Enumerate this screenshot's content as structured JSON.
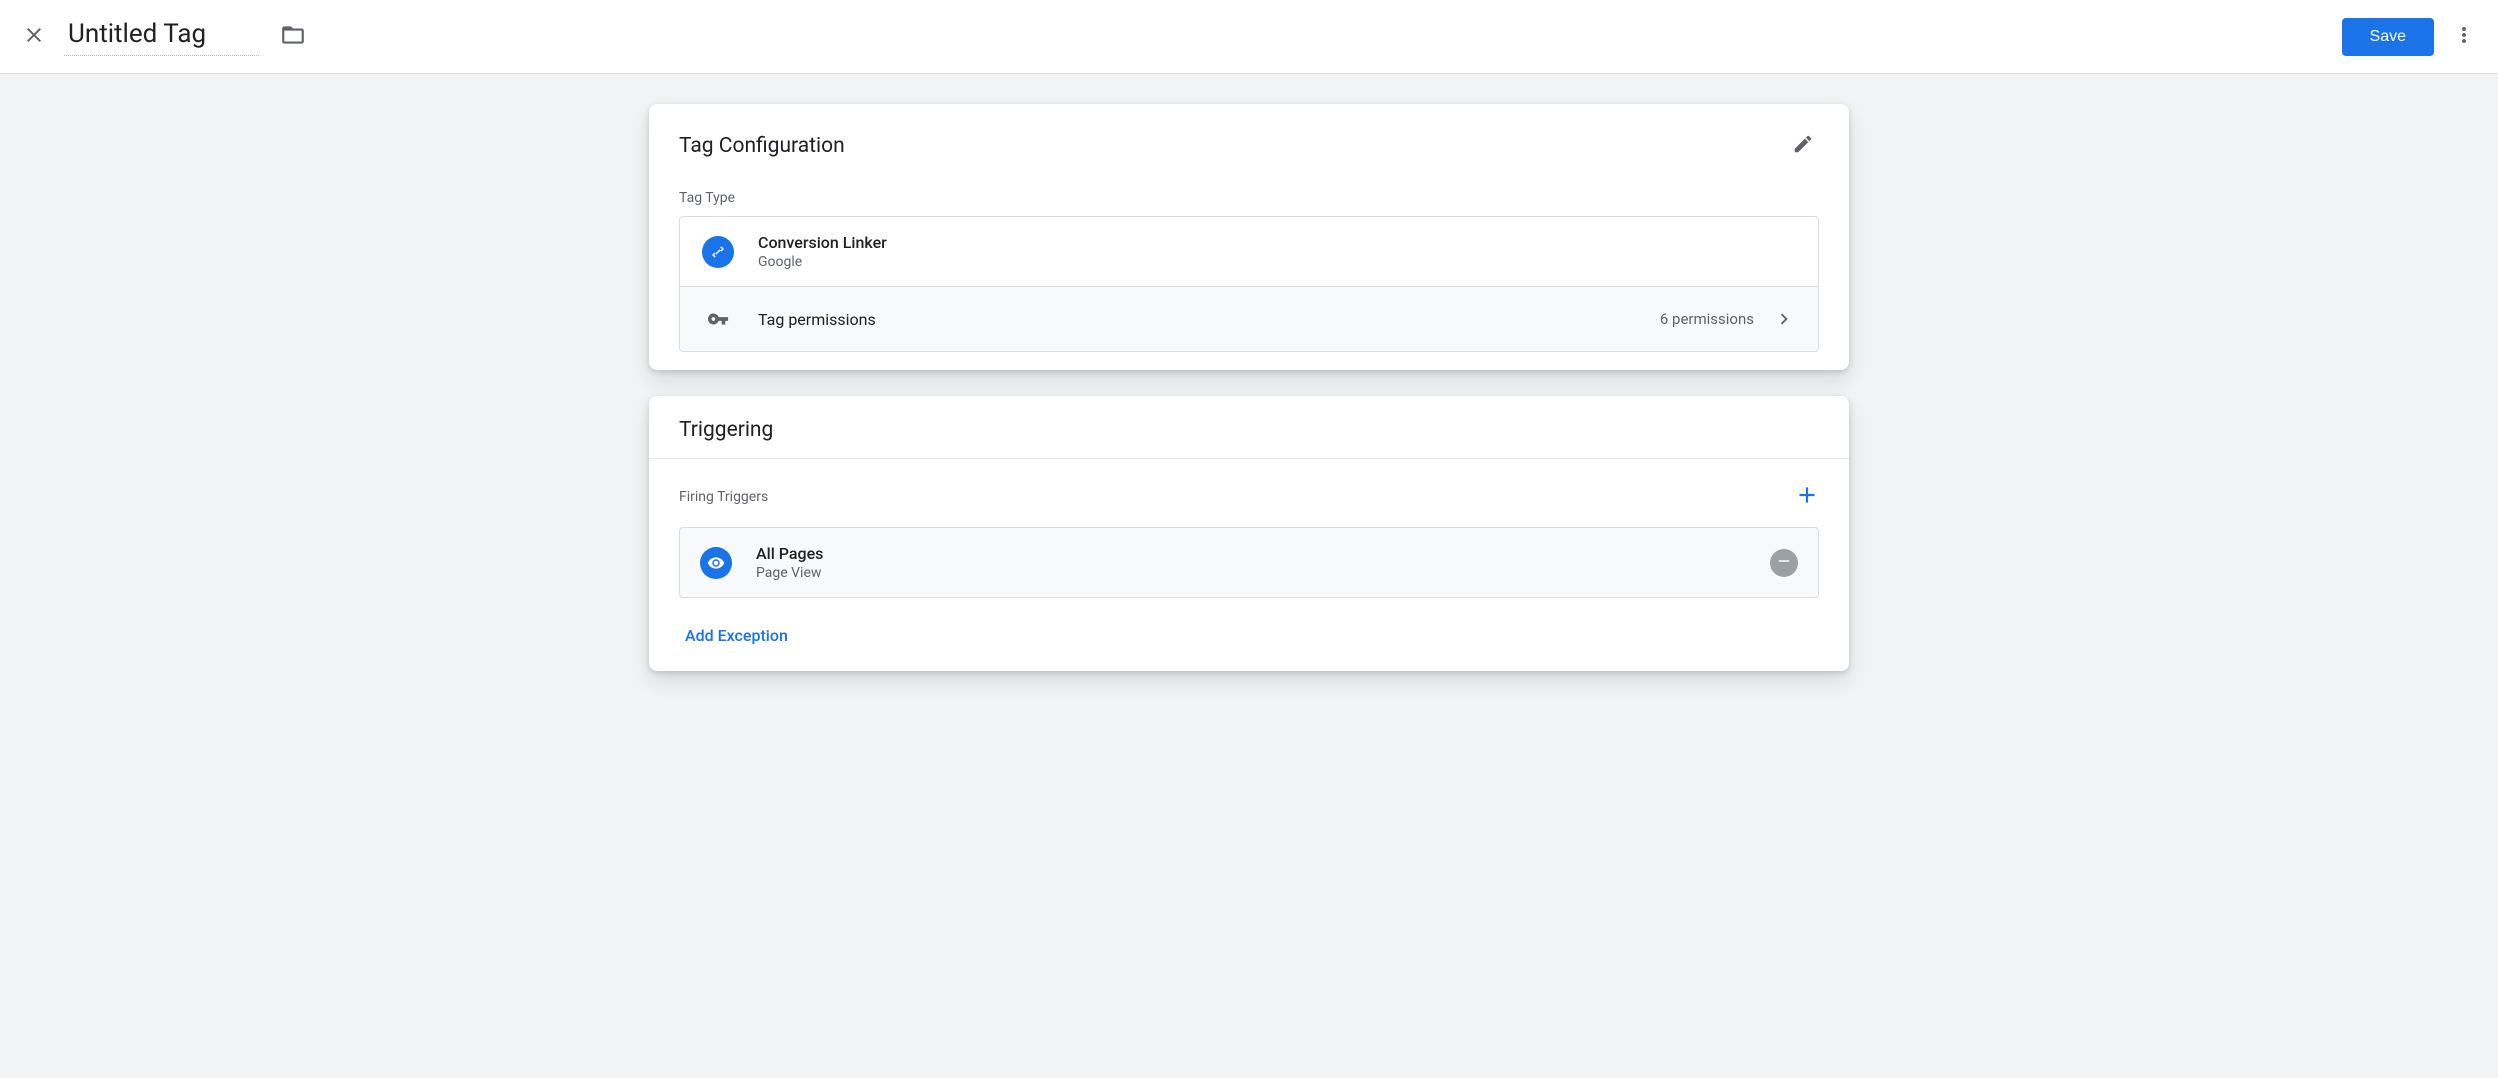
{
  "header": {
    "title": "Untitled Tag",
    "save_label": "Save"
  },
  "tag_config": {
    "card_title": "Tag Configuration",
    "tag_type_label": "Tag Type",
    "type_name": "Conversion Linker",
    "type_vendor": "Google",
    "permissions_label": "Tag permissions",
    "permissions_count": "6 permissions"
  },
  "triggering": {
    "card_title": "Triggering",
    "firing_label": "Firing Triggers",
    "triggers": [
      {
        "name": "All Pages",
        "type": "Page View"
      }
    ],
    "add_exception_label": "Add Exception"
  }
}
